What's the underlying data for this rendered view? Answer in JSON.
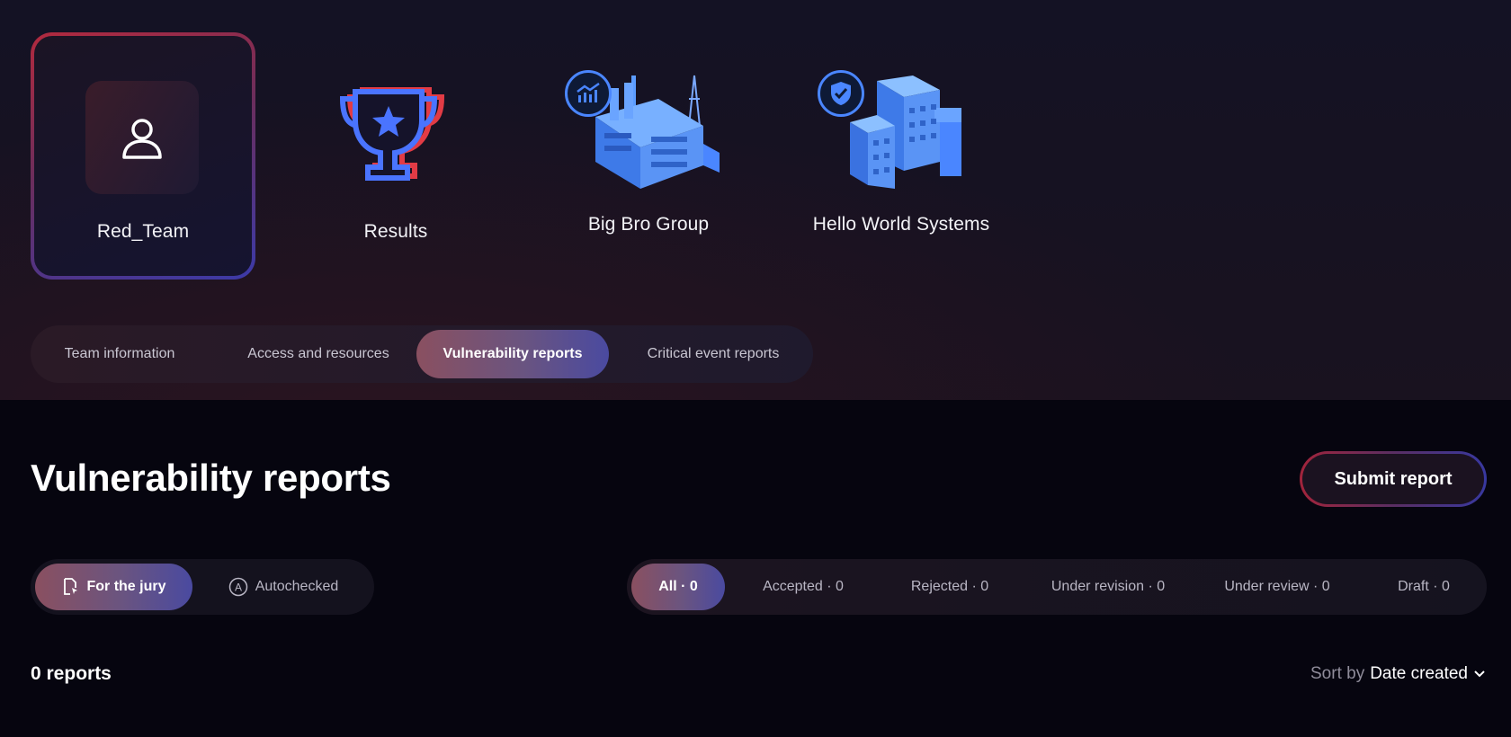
{
  "nav": {
    "tiles": [
      {
        "label": "Red_Team",
        "icon": "user-icon",
        "active": true
      },
      {
        "label": "Results",
        "icon": "trophy-icon",
        "active": false
      },
      {
        "label": "Big Bro Group",
        "icon": "factory-icon",
        "active": false
      },
      {
        "label": "Hello World Systems",
        "icon": "office-building-icon",
        "active": false
      }
    ]
  },
  "tabs": [
    {
      "label": "Team information"
    },
    {
      "label": "Access and resources"
    },
    {
      "label": "Vulnerability reports",
      "active": true
    },
    {
      "label": "Critical event reports"
    }
  ],
  "page": {
    "title": "Vulnerability reports",
    "submit_label": "Submit report"
  },
  "source_filter": [
    {
      "label": "For the jury",
      "icon": "document-cursor-icon",
      "active": true
    },
    {
      "label": "Autochecked",
      "icon": "letter-a-circle-icon"
    }
  ],
  "status_filter": [
    {
      "label": "All · 0",
      "active": true
    },
    {
      "label": "Accepted · 0"
    },
    {
      "label": "Rejected · 0"
    },
    {
      "label": "Under revision · 0"
    },
    {
      "label": "Under review · 0"
    },
    {
      "label": "Draft · 0"
    }
  ],
  "list": {
    "count": "0 reports",
    "sort_prefix": "Sort by",
    "sort_value": "Date created"
  },
  "colors": {
    "accent_red": "#b22a3e",
    "accent_blue": "#3c3aa8",
    "illustration_blue": "#4a86ff"
  }
}
